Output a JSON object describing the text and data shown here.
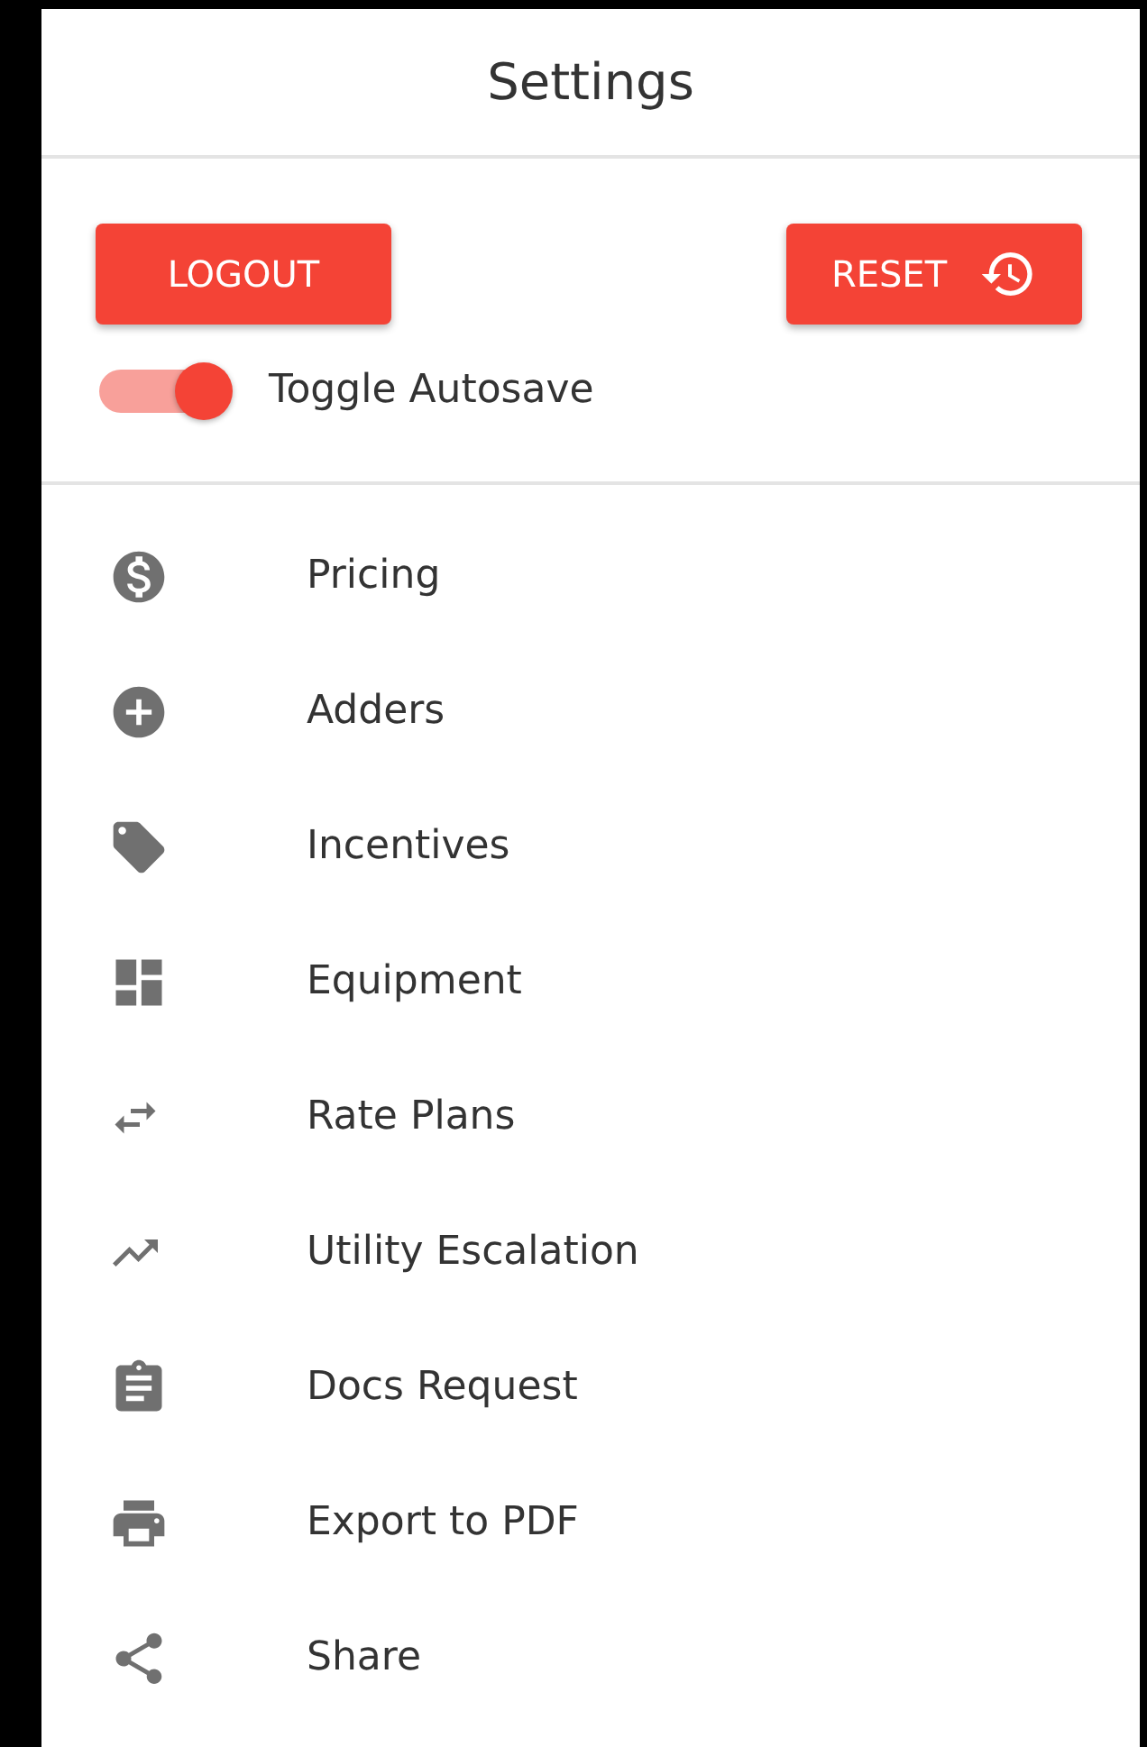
{
  "header": {
    "title": "Settings"
  },
  "buttons": [
    {
      "label": "LOGOUT"
    },
    {
      "label": "RESET"
    }
  ],
  "autosave": {
    "label": "Toggle Autosave",
    "on": true
  },
  "menu": [
    {
      "label": "Pricing"
    },
    {
      "label": "Adders"
    },
    {
      "label": "Incentives"
    },
    {
      "label": "Equipment"
    },
    {
      "label": "Rate Plans"
    },
    {
      "label": "Utility Escalation"
    },
    {
      "label": "Docs Request"
    },
    {
      "label": "Export to PDF"
    },
    {
      "label": "Share"
    }
  ]
}
